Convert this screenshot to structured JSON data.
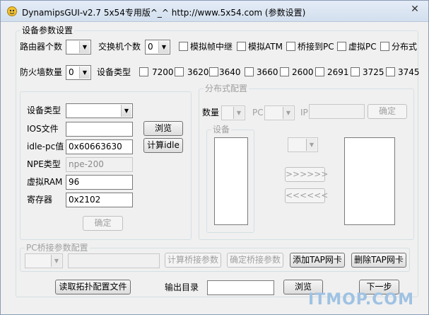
{
  "window": {
    "title": "DynamipsGUI-v2.7   5x54专用版^_^ http://www.5x54.com  (参数设置)",
    "close_glyph": "✕"
  },
  "device_params": {
    "legend": "设备参数设置",
    "router_count_label": "路由器个数",
    "router_count_value": "",
    "switch_count_label": "交换机个数",
    "switch_count_value": "0",
    "checks": [
      {
        "label": "模拟帧中继",
        "checked": false
      },
      {
        "label": "模拟ATM",
        "checked": false
      },
      {
        "label": "桥接到PC",
        "checked": false
      },
      {
        "label": "虚拟PC",
        "checked": false
      },
      {
        "label": "分布式",
        "checked": false
      }
    ],
    "firewall_count_label": "防火墙数量",
    "firewall_count_value": "0",
    "device_type_label": "设备类型",
    "types": [
      {
        "label": "7200",
        "checked": false
      },
      {
        "label": "3620",
        "checked": false
      },
      {
        "label": "3640",
        "checked": false
      },
      {
        "label": "3660",
        "checked": false
      },
      {
        "label": "2600",
        "checked": false
      },
      {
        "label": "2691",
        "checked": false
      },
      {
        "label": "3725",
        "checked": false
      },
      {
        "label": "3745",
        "checked": false
      }
    ]
  },
  "left_panel": {
    "device_type_label": "设备类型",
    "device_type_value": "",
    "ios_label": "IOS文件",
    "ios_value": "",
    "browse_label": "浏览",
    "idlepc_label": "idle-pc值",
    "idlepc_value": "0x60663630",
    "calc_idle_label": "计算idle",
    "npe_label": "NPE类型",
    "npe_value": "npe-200",
    "ram_label": "虚拟RAM",
    "ram_value": "96",
    "register_label": "寄存器",
    "register_value": "0x2102",
    "confirm_label": "确定"
  },
  "distributed": {
    "legend": "分布式配置",
    "count_label": "数量",
    "pc_label": "PC",
    "ip_label": "IP",
    "confirm_label": "确定",
    "device_legend": "设备",
    "add_arrow": ">>>>>>",
    "remove_arrow": "<<<<<<"
  },
  "bridge": {
    "legend": "PC桥接参数配置",
    "calc_label": "计算桥接参数",
    "confirm_label": "确定桥接参数",
    "add_tap_label": "添加TAP网卡",
    "del_tap_label": "删除TAP网卡"
  },
  "footer": {
    "read_topology_label": "读取拓扑配置文件",
    "output_dir_label": "输出目录",
    "output_dir_value": "",
    "browse_label": "浏览",
    "next_label": "下一步"
  },
  "watermark": "ITMOP.COM"
}
